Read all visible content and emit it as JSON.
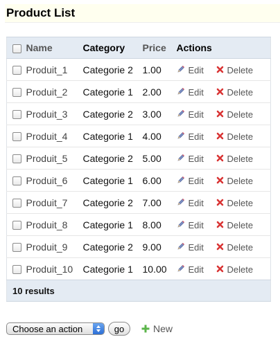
{
  "page": {
    "title": "Product List"
  },
  "table": {
    "headers": {
      "name": "Name",
      "category": "Category",
      "price": "Price",
      "actions": "Actions"
    },
    "rows": [
      {
        "name": "Produit_1",
        "category": "Categorie 2",
        "price": "1.00"
      },
      {
        "name": "Produit_2",
        "category": "Categorie 1",
        "price": "2.00"
      },
      {
        "name": "Produit_3",
        "category": "Categorie 2",
        "price": "3.00"
      },
      {
        "name": "Produit_4",
        "category": "Categorie 1",
        "price": "4.00"
      },
      {
        "name": "Produit_5",
        "category": "Categorie 2",
        "price": "5.00"
      },
      {
        "name": "Produit_6",
        "category": "Categorie 1",
        "price": "6.00"
      },
      {
        "name": "Produit_7",
        "category": "Categorie 2",
        "price": "7.00"
      },
      {
        "name": "Produit_8",
        "category": "Categorie 1",
        "price": "8.00"
      },
      {
        "name": "Produit_9",
        "category": "Categorie 2",
        "price": "9.00"
      },
      {
        "name": "Produit_10",
        "category": "Categorie 1",
        "price": "10.00"
      }
    ],
    "edit_label": "Edit",
    "delete_label": "Delete",
    "edit_icon": "pencil-icon",
    "delete_icon": "red-x-icon",
    "footer": "10 results"
  },
  "bottom": {
    "action_select": "Choose an action",
    "go_label": "go",
    "new_label": "New",
    "new_icon": "green-plus-icon"
  },
  "colors": {
    "header_bg": "#e4ebf3",
    "title_bg": "#ffffef",
    "delete_red": "#d93434",
    "new_green": "#5bb54a"
  }
}
